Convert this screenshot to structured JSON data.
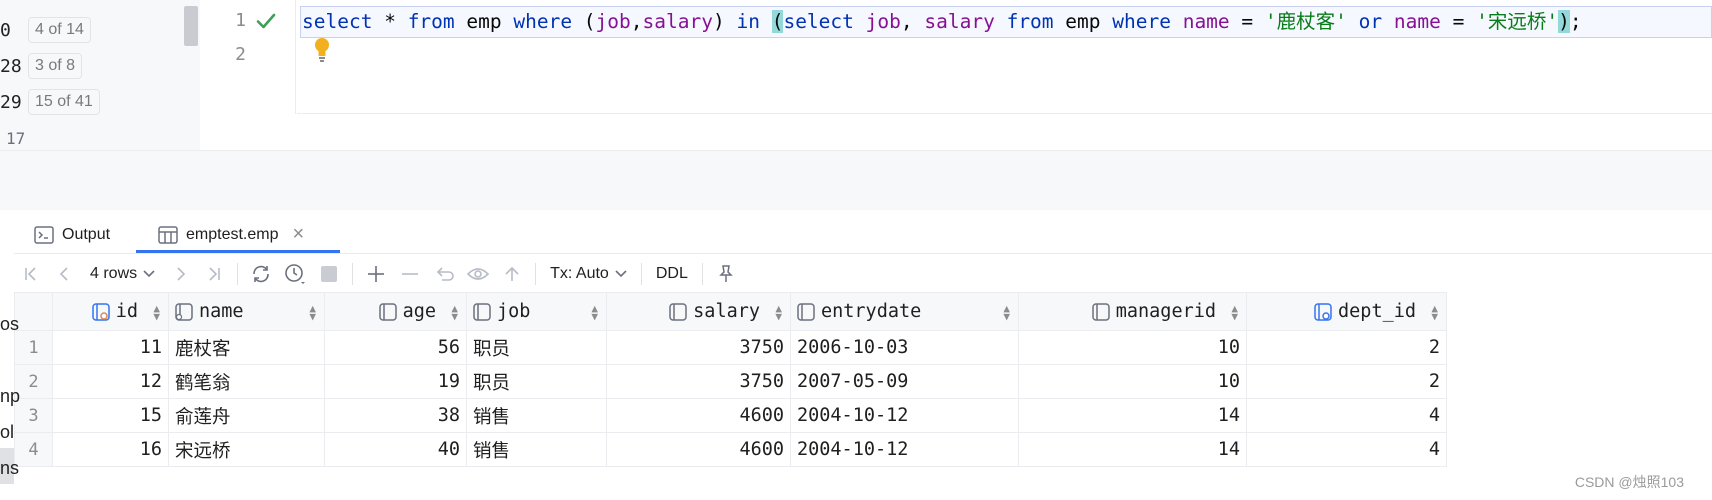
{
  "hints": [
    {
      "num": "0",
      "badge": "4 of 14"
    },
    {
      "num": "28",
      "badge": "3 of 8"
    },
    {
      "num": "29",
      "badge": "15 of 41"
    },
    {
      "num": "17",
      "badge": ""
    }
  ],
  "editor": {
    "line_numbers": [
      "1",
      "2"
    ],
    "sql_tokens": [
      {
        "t": "select",
        "c": "kw"
      },
      {
        "t": " * ",
        "c": ""
      },
      {
        "t": "from",
        "c": "kw"
      },
      {
        "t": " emp ",
        "c": ""
      },
      {
        "t": "where",
        "c": "kw"
      },
      {
        "t": " (",
        "c": ""
      },
      {
        "t": "job",
        "c": "id"
      },
      {
        "t": ",",
        "c": ""
      },
      {
        "t": "salary",
        "c": "id"
      },
      {
        "t": ") ",
        "c": ""
      },
      {
        "t": "in",
        "c": "kw"
      },
      {
        "t": " ",
        "c": ""
      },
      {
        "t": "(",
        "c": "paren-hl"
      },
      {
        "t": "select",
        "c": "kw"
      },
      {
        "t": " ",
        "c": ""
      },
      {
        "t": "job",
        "c": "id"
      },
      {
        "t": ", ",
        "c": ""
      },
      {
        "t": "salary",
        "c": "id"
      },
      {
        "t": " ",
        "c": ""
      },
      {
        "t": "from",
        "c": "kw"
      },
      {
        "t": " emp ",
        "c": ""
      },
      {
        "t": "where",
        "c": "kw"
      },
      {
        "t": " ",
        "c": ""
      },
      {
        "t": "name",
        "c": "id"
      },
      {
        "t": " = ",
        "c": ""
      },
      {
        "t": "'鹿杖客'",
        "c": "str"
      },
      {
        "t": " ",
        "c": ""
      },
      {
        "t": "or",
        "c": "kw"
      },
      {
        "t": " ",
        "c": ""
      },
      {
        "t": "name",
        "c": "id"
      },
      {
        "t": " = ",
        "c": ""
      },
      {
        "t": "'宋远桥'",
        "c": "str"
      },
      {
        "t": ")",
        "c": "paren-hl"
      },
      {
        "t": ";",
        "c": ""
      }
    ]
  },
  "tabs": [
    {
      "label": "Output",
      "icon": "console-icon"
    },
    {
      "label": "emptest.emp",
      "icon": "table-icon",
      "close": "×"
    }
  ],
  "toolbar": {
    "rows_label": "4 rows",
    "tx_label": "Tx: Auto",
    "ddl_label": "DDL"
  },
  "grid": {
    "columns": [
      "id",
      "name",
      "age",
      "job",
      "salary",
      "entrydate",
      "managerid",
      "dept_id"
    ],
    "rows": [
      {
        "n": "1",
        "id": "11",
        "name": "鹿杖客",
        "age": "56",
        "job": "职员",
        "salary": "3750",
        "entrydate": "2006-10-03",
        "managerid": "10",
        "dept_id": "2"
      },
      {
        "n": "2",
        "id": "12",
        "name": "鹤笔翁",
        "age": "19",
        "job": "职员",
        "salary": "3750",
        "entrydate": "2007-05-09",
        "managerid": "10",
        "dept_id": "2"
      },
      {
        "n": "3",
        "id": "15",
        "name": "俞莲舟",
        "age": "38",
        "job": "销售",
        "salary": "4600",
        "entrydate": "2004-10-12",
        "managerid": "14",
        "dept_id": "4"
      },
      {
        "n": "4",
        "id": "16",
        "name": "宋远桥",
        "age": "40",
        "job": "销售",
        "salary": "4600",
        "entrydate": "2004-10-12",
        "managerid": "14",
        "dept_id": "4"
      }
    ]
  },
  "left_fragments": [
    "os",
    "np",
    "ol",
    "ns"
  ],
  "watermark": "CSDN @烛照103",
  "colors": {
    "accent": "#3574f0",
    "keyword": "#0033b3",
    "identifier": "#871094",
    "string": "#067d17"
  }
}
